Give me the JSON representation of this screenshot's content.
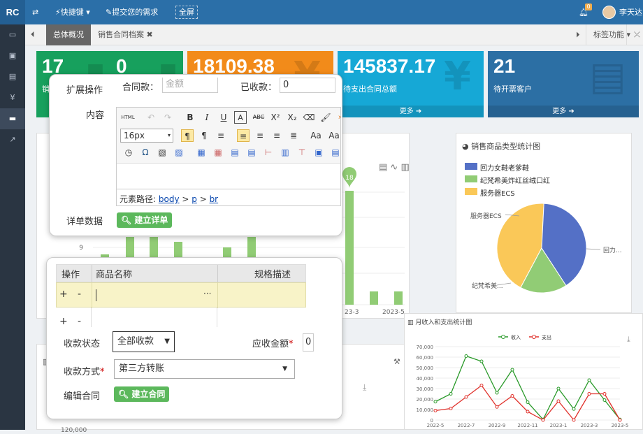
{
  "topbar": {
    "logo": "RC",
    "shortcuts": "快捷键",
    "submit_request": "提交您的需求",
    "fullscreen": "全屏",
    "notification_count": "0",
    "username": "李天达"
  },
  "tabs": {
    "overview": "总体概况",
    "contracts": "销售合同档案",
    "tag_features": "标签功能"
  },
  "cards": [
    {
      "num": "17",
      "label": "销",
      "color": "#17a05d"
    },
    {
      "num": "0",
      "label": "",
      "color": "#17a05d"
    },
    {
      "num": "18109.38",
      "label": "",
      "color": "#f28b1a",
      "icon": "¥"
    },
    {
      "num": "145837.17",
      "label": "待支出合同总额",
      "more": "更多",
      "color": "#16a8d6",
      "icon": "¥"
    },
    {
      "num": "21",
      "label": "待开票客户",
      "more": "更多",
      "color": "#2c6fa4"
    }
  ],
  "modal1": {
    "ext_ops_label": "扩展操作",
    "contract_amount_label": "合同款：",
    "contract_amount_placeholder": "金额",
    "received_label": "已收款：",
    "received_value": "0",
    "content_label": "内容",
    "font_size": "16px",
    "element_path_label": "元素路径:",
    "path_body": "body",
    "path_p": "p",
    "path_br": "br",
    "detail_label": "详单数据",
    "create_detail_button": "建立详单"
  },
  "modal2": {
    "col_ops": "操作",
    "col_product": "商品名称",
    "col_spec": "规格描述",
    "row_plus": "+",
    "row_minus": "-",
    "ellipsis": "···",
    "payment_status_label": "收款状态",
    "payment_status_value": "全部收款",
    "receivable_label": "应收金额",
    "receivable_value": "0",
    "payment_method_label": "收款方式",
    "payment_method_value": "第三方转账",
    "edit_contract_label": "编辑合同",
    "create_contract_button": "建立合同"
  },
  "bar_chart_partial": {
    "peak_label": "18",
    "ytick": "9",
    "xticks": [
      "23-3",
      "2023-5"
    ],
    "bg_tick": "120,000"
  },
  "pie_panel": {
    "title": "销售商品类型统计图",
    "legend": [
      "回力女鞋老爹鞋",
      "纪梵希美炸红丝绒口红",
      "服务器ECS"
    ],
    "labels": [
      "服务器ECS",
      "回力...",
      "纪梵希美..."
    ],
    "colors": [
      "#5470c6",
      "#91cc75",
      "#fac858"
    ],
    "chart_data": {
      "type": "pie",
      "categories": [
        "回力女鞋老爹鞋",
        "纪梵希美炸红丝绒口红",
        "服务器ECS"
      ],
      "values": [
        40,
        17,
        43
      ]
    }
  },
  "line_panel": {
    "title": "月收入和支出统计图",
    "legend": [
      "收入",
      "支出"
    ],
    "chart_data": {
      "type": "line",
      "x": [
        "2022-5",
        "2022-6",
        "2022-7",
        "2022-8",
        "2022-9",
        "2022-10",
        "2022-11",
        "2022-12",
        "2023-1",
        "2023-2",
        "2023-3",
        "2023-4",
        "2023-5"
      ],
      "xticks": [
        "2022-5",
        "2022-7",
        "2022-9",
        "2022-11",
        "2023-1",
        "2023-3",
        "2023-5"
      ],
      "yticks": [
        "0",
        "10,000",
        "20,000",
        "30,000",
        "40,000",
        "50,000",
        "60,000",
        "70,000"
      ],
      "ylim": [
        0,
        70000
      ],
      "series": [
        {
          "name": "收入",
          "color": "#2a9a2a",
          "values": [
            17500,
            25000,
            61000,
            56000,
            26000,
            48000,
            17000,
            500,
            30000,
            10500,
            38000,
            19000,
            500
          ]
        },
        {
          "name": "支出",
          "color": "#e0302a",
          "values": [
            9000,
            11000,
            22000,
            33000,
            12500,
            23000,
            8000,
            0,
            18000,
            0,
            25000,
            25000,
            0
          ]
        }
      ]
    }
  }
}
